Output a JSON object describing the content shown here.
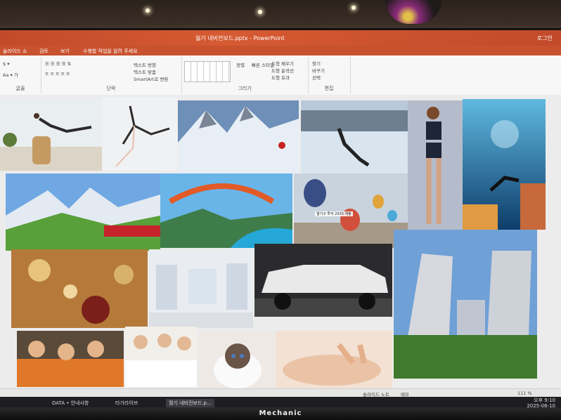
{
  "window": {
    "title": "월기 내비전보드.pptx - PowerPoint",
    "user": "로그인"
  },
  "menu": {
    "items": [
      "슬라이드 쇼",
      "검토",
      "보기"
    ],
    "tell_me": "수행할 작업을 알려 주세요"
  },
  "ribbon": {
    "font_label": "글꼴",
    "paragraph_label": "단락",
    "text_direction": "텍스트 방향",
    "align_text": "텍스트 맞춤",
    "smartart": "SmartArt로 변환",
    "drawing_label": "그리기",
    "arrange": "정렬",
    "quick_styles": "빠른 스타일",
    "shape_fill": "도형 채우기",
    "shape_outline": "도형 윤곽선",
    "shape_effects": "도형 효과",
    "find": "찾기",
    "replace": "바꾸기",
    "select": "선택",
    "editing_label": "편집"
  },
  "slide": {
    "image_caption": "열기구 투어 2025 캐플"
  },
  "status": {
    "notes": "슬라이드 노트",
    "comments": "메모",
    "zoom": "111 %"
  },
  "taskbar": {
    "items": [
      "DATA • 안내사항",
      "타가라이브",
      "월기 내비전보드.p..."
    ],
    "time": "오후 9:10",
    "date": "2025-06-10"
  },
  "monitor": {
    "brand": "Mechanic"
  }
}
